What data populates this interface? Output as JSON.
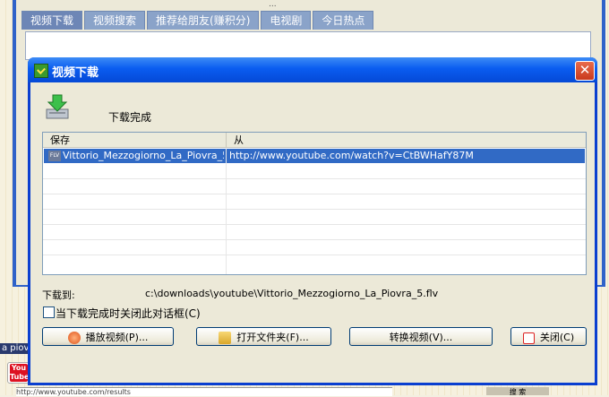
{
  "background": {
    "top_text": "...",
    "tabs": [
      {
        "label": "视频下载",
        "active": true
      },
      {
        "label": "视频搜索",
        "active": false
      },
      {
        "label": "推荐给朋友(赚积分)",
        "active": false
      },
      {
        "label": "电视剧",
        "active": false
      },
      {
        "label": "今日热点",
        "active": false
      }
    ],
    "side_text": "a piov",
    "youtube_icon_label": "You Tube",
    "url_text": "http://www.youtube.com/results",
    "button_label": "搜 索"
  },
  "dialog": {
    "title": "视频下载",
    "close_symbol": "✕",
    "status": "下载完成",
    "columns": [
      "保存",
      "从"
    ],
    "rows": [
      {
        "file_type": "FLV",
        "file": "Vittorio_Mezzogiorno_La_Piovra_5....",
        "source": "http://www.youtube.com/watch?v=CtBWHafY87M"
      }
    ],
    "dest_label": "下载到:",
    "dest_path": "c:\\downloads\\youtube\\Vittorio_Mezzogiorno_La_Piovra_5.flv",
    "auto_close_label": "当下载完成时关闭此对话框(C)",
    "auto_close_checked": false,
    "buttons": {
      "play": "播放视频(P)...",
      "open_folder": "打开文件夹(F)...",
      "convert": "转换视频(V)...",
      "close": "关闭(C)"
    }
  }
}
